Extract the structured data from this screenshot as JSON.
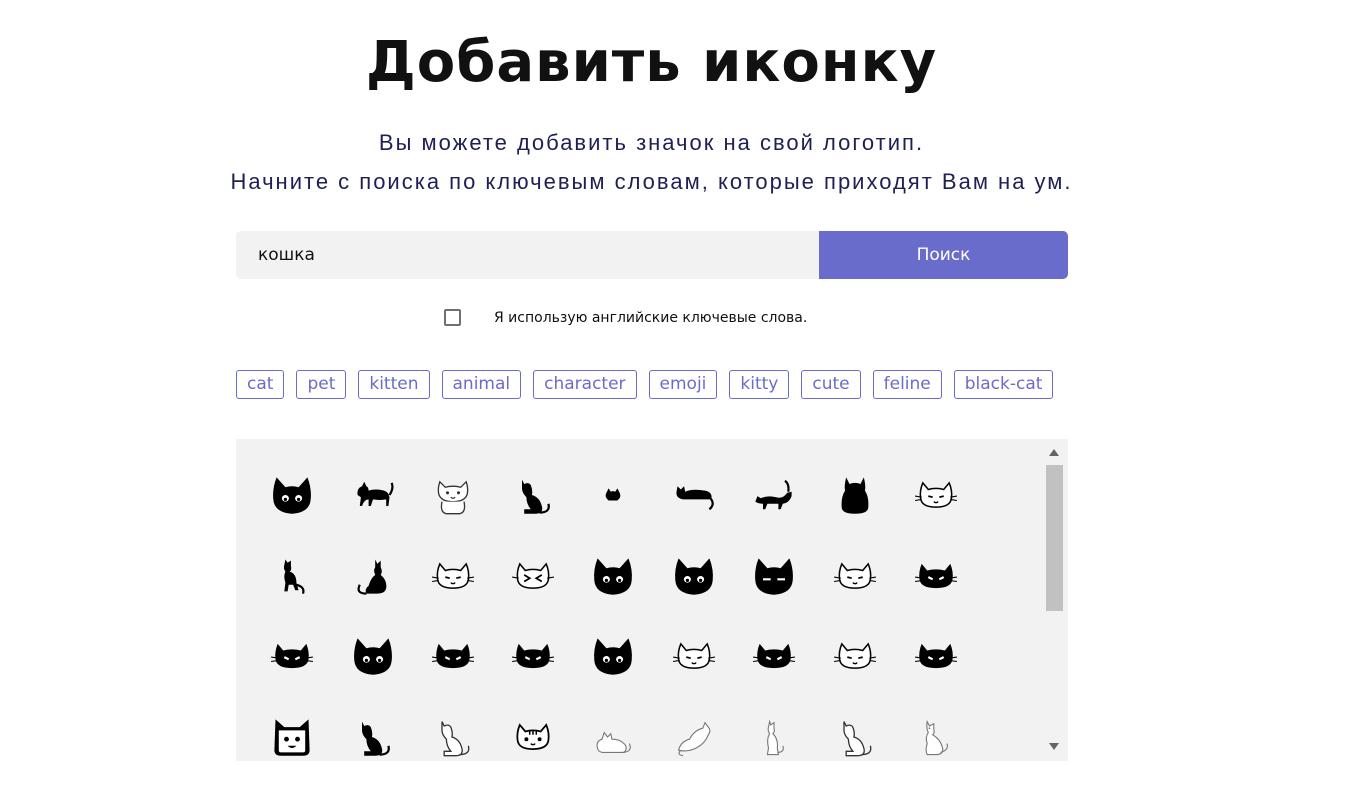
{
  "header": {
    "title": "Добавить иконку",
    "subtitle_line1": "Вы можете добавить значок на свой логотип.",
    "subtitle_line2": "Начните с поиска по ключевым словам, которые приходят Вам на ум."
  },
  "search": {
    "value": "кошка",
    "button_label": "Поиск"
  },
  "english_keywords": {
    "label": "Я использую английские ключевые слова.",
    "checked": false
  },
  "tags": [
    "cat",
    "pet",
    "kitten",
    "animal",
    "character",
    "emoji",
    "kitty",
    "cute",
    "feline",
    "black-cat"
  ],
  "icons": {
    "rows": [
      [
        "black-cat-face-icon",
        "walking-cat-icon",
        "cute-cat-outline-icon",
        "sitting-cat-icon",
        "small-cat-icon",
        "lying-cat-icon",
        "stretching-cat-icon",
        "fat-cat-icon",
        "cat-face-outline-icon"
      ],
      [
        "standing-cat-icon",
        "sitting-cat-back-icon",
        "cat-face-outline-icon",
        "cat-face-squint-icon",
        "black-cat-face-icon",
        "black-cat-face-icon",
        "black-cat-face-sleepy-icon",
        "cat-face-outline-icon",
        "black-cat-face-wide-icon"
      ],
      [
        "black-cat-face-wide-icon",
        "black-cat-face-icon",
        "black-cat-face-wide-icon",
        "black-cat-face-wide-icon",
        "black-cat-face-icon",
        "cat-face-outline-icon",
        "black-cat-face-wide-icon",
        "cat-face-outline-icon",
        "black-cat-face-wide-icon"
      ],
      [
        "square-cat-face-icon",
        "sitting-cat-icon",
        "sitting-cat-outline-icon",
        "striped-cat-face-icon",
        "lying-cat-outline-icon",
        "playing-cat-outline-icon",
        "thin-cat-outline-icon",
        "sitting-cat-outline-icon",
        "cat-outline-icon"
      ]
    ]
  }
}
